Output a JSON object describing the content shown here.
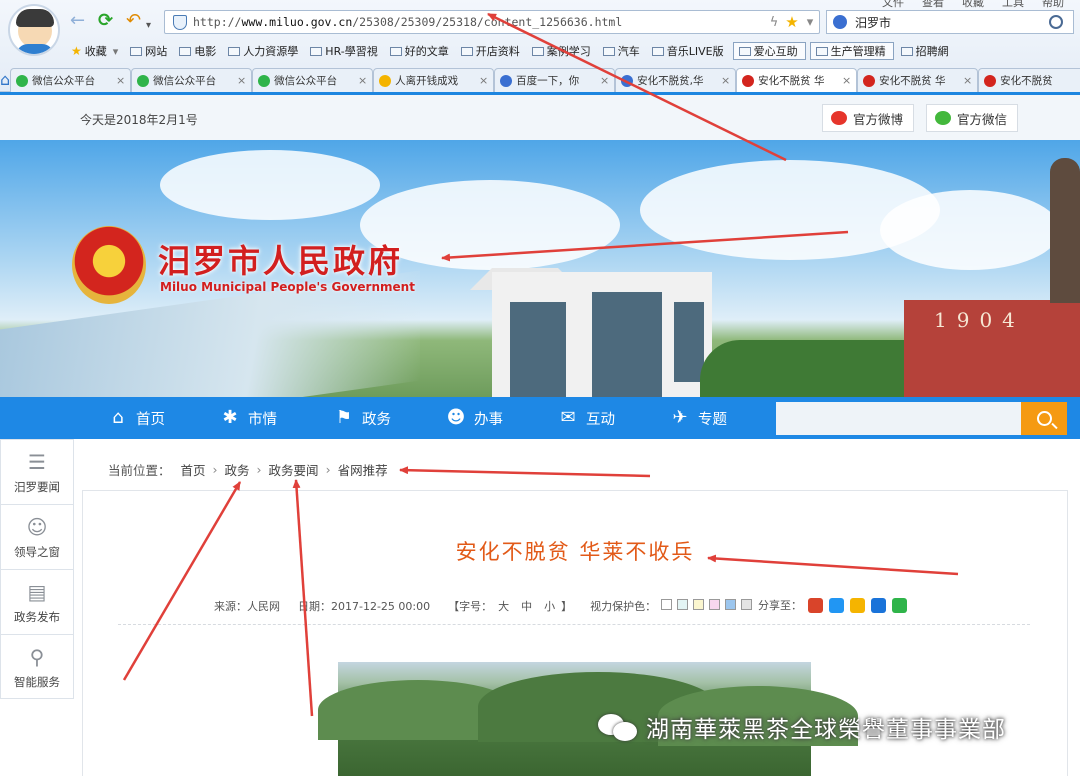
{
  "browser": {
    "menu": [
      "文件",
      "查看",
      "收藏",
      "工具",
      "帮助"
    ],
    "url_prefix": "http://",
    "url_host": "www.miluo.gov.cn",
    "url_path": "/25308/25309/25318/content_1256636.html",
    "search_value": "汨罗市",
    "bookmarks": [
      "收藏",
      "网站",
      "电影",
      "人力資源學",
      "HR-學習視",
      "好的文章",
      "开店资料",
      "案例学习",
      "汽车",
      "音乐LIVE版",
      "爱心互助",
      "生产管理精",
      "招聘網"
    ],
    "tabs": [
      {
        "label": "微信公众平台",
        "color": "#2fb44a",
        "active": false
      },
      {
        "label": "微信公众平台",
        "color": "#2fb44a",
        "active": false
      },
      {
        "label": "微信公众平台",
        "color": "#2fb44a",
        "active": false
      },
      {
        "label": "人离开钱成戏",
        "color": "#f4b400",
        "active": false
      },
      {
        "label": "百度一下，你",
        "color": "#3a6fd1",
        "active": false
      },
      {
        "label": "安化不脱贫,华",
        "color": "#3a6fd1",
        "active": false
      },
      {
        "label": "安化不脱贫 华",
        "color": "#d3251e",
        "active": true
      },
      {
        "label": "安化不脱贫 华",
        "color": "#d3251e",
        "active": false
      },
      {
        "label": "安化不脱贫",
        "color": "#d3251e",
        "active": false
      }
    ]
  },
  "site": {
    "date_text": "今天是2018年2月1号",
    "weibo_label": "官方微博",
    "wechat_label": "官方微信",
    "title_cn": "汨罗市人民政府",
    "title_en": "Miluo Municipal People's Government",
    "monument_year": "1904",
    "nav": [
      "首页",
      "市情",
      "政务",
      "办事",
      "互动",
      "专题"
    ],
    "sidebar": [
      "汨罗要闻",
      "领导之窗",
      "政务发布",
      "智能服务"
    ],
    "breadcrumb_label": "当前位置：",
    "breadcrumb": [
      "首页",
      "政务",
      "政务要闻",
      "省网推荐"
    ]
  },
  "article": {
    "title": "安化不脱贫  华莱不收兵",
    "source": "来源：人民网",
    "date": "日期：2017-12-25 00:00",
    "font_label": "【字号：",
    "font_sizes": [
      "大",
      "中",
      "小"
    ],
    "font_end": "】",
    "eye_label": "视力保护色：",
    "eye_colors": [
      "#ffffff",
      "#e3f4f4",
      "#fbf6cf",
      "#f7d7ee",
      "#9cc6ee",
      "#e4e4e4"
    ],
    "share_label": "分享至：",
    "share_colors": [
      "#d9442a",
      "#2196f3",
      "#f5b400",
      "#1a73d9",
      "#2fb44a"
    ]
  },
  "watermark": "湖南華萊黑茶全球榮譽董事事業部"
}
